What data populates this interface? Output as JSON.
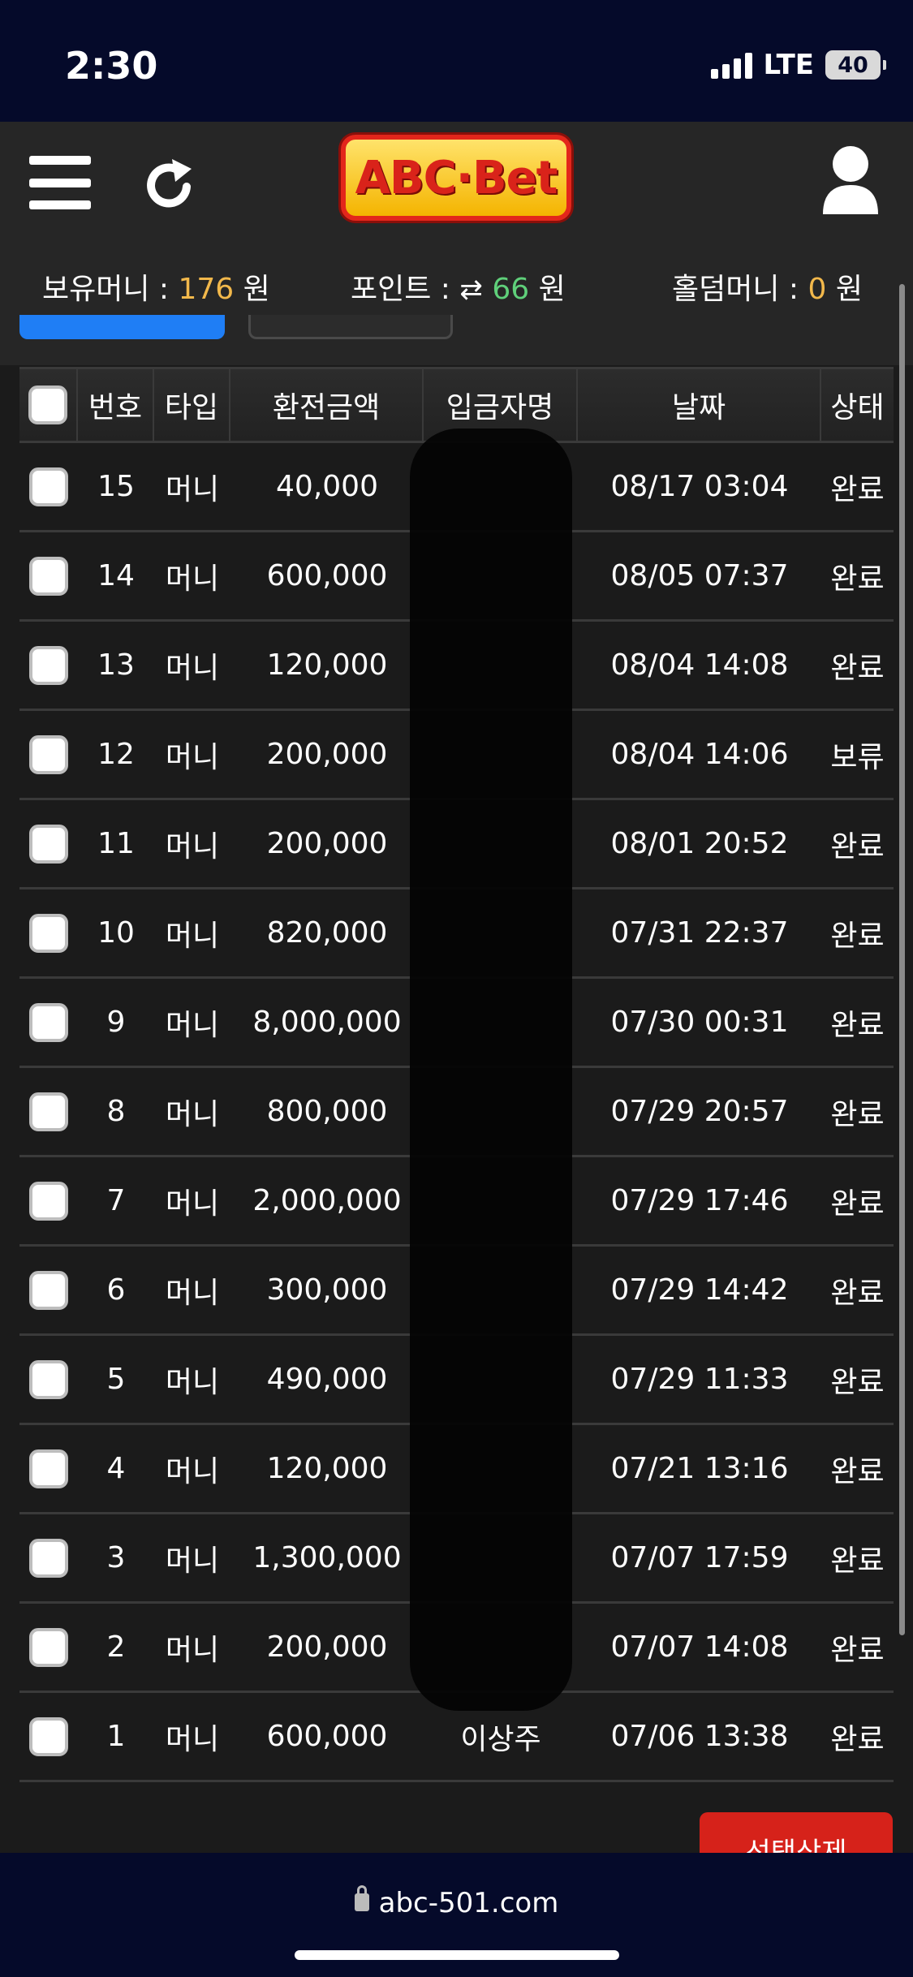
{
  "status_bar": {
    "time": "2:30",
    "network": "LTE",
    "battery": "40"
  },
  "header": {
    "logo_text": "ABC·Bet"
  },
  "balances": {
    "money_label": "보유머니 : ",
    "money_value": "176",
    "point_label": "포인트 : ",
    "point_icon": "⇄",
    "point_value": "66",
    "holdem_label": "홀덤머니 : ",
    "holdem_value": "0",
    "unit": "원"
  },
  "colors": {
    "accent_yellow": "#f2b84b",
    "accent_green": "#5fd07a",
    "delete_red": "#d6221a",
    "tab_blue": "#1f7ef5"
  },
  "table": {
    "headers": [
      "번호",
      "타입",
      "환전금액",
      "입금자명",
      "날짜",
      "상태"
    ],
    "rows": [
      {
        "no": "15",
        "type": "머니",
        "amount": "40,000",
        "name": "",
        "date": "08/17 03:04",
        "status": "완료"
      },
      {
        "no": "14",
        "type": "머니",
        "amount": "600,000",
        "name": "",
        "date": "08/05 07:37",
        "status": "완료"
      },
      {
        "no": "13",
        "type": "머니",
        "amount": "120,000",
        "name": "",
        "date": "08/04 14:08",
        "status": "완료"
      },
      {
        "no": "12",
        "type": "머니",
        "amount": "200,000",
        "name": "",
        "date": "08/04 14:06",
        "status": "보류"
      },
      {
        "no": "11",
        "type": "머니",
        "amount": "200,000",
        "name": "",
        "date": "08/01 20:52",
        "status": "완료"
      },
      {
        "no": "10",
        "type": "머니",
        "amount": "820,000",
        "name": "",
        "date": "07/31 22:37",
        "status": "완료"
      },
      {
        "no": "9",
        "type": "머니",
        "amount": "8,000,000",
        "name": "",
        "date": "07/30 00:31",
        "status": "완료"
      },
      {
        "no": "8",
        "type": "머니",
        "amount": "800,000",
        "name": "",
        "date": "07/29 20:57",
        "status": "완료"
      },
      {
        "no": "7",
        "type": "머니",
        "amount": "2,000,000",
        "name": "",
        "date": "07/29 17:46",
        "status": "완료"
      },
      {
        "no": "6",
        "type": "머니",
        "amount": "300,000",
        "name": "",
        "date": "07/29 14:42",
        "status": "완료"
      },
      {
        "no": "5",
        "type": "머니",
        "amount": "490,000",
        "name": "",
        "date": "07/29 11:33",
        "status": "완료"
      },
      {
        "no": "4",
        "type": "머니",
        "amount": "120,000",
        "name": "",
        "date": "07/21 13:16",
        "status": "완료"
      },
      {
        "no": "3",
        "type": "머니",
        "amount": "1,300,000",
        "name": "",
        "date": "07/07 17:59",
        "status": "완료"
      },
      {
        "no": "2",
        "type": "머니",
        "amount": "200,000",
        "name": "",
        "date": "07/07 14:08",
        "status": "완료"
      },
      {
        "no": "1",
        "type": "머니",
        "amount": "600,000",
        "name": "이상주",
        "date": "07/06 13:38",
        "status": "완료"
      }
    ]
  },
  "actions": {
    "delete_selected": "선택삭제"
  },
  "browser": {
    "url": "abc-501.com"
  }
}
